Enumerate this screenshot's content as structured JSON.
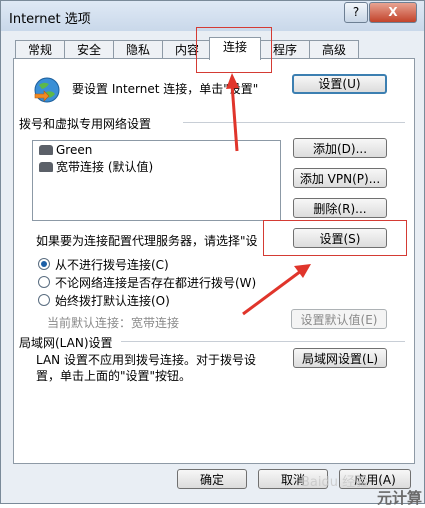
{
  "window": {
    "title": "Internet 选项",
    "help_label": "?",
    "close_label": "X"
  },
  "tabs": [
    "常规",
    "安全",
    "隐私",
    "内容",
    "连接",
    "程序",
    "高级"
  ],
  "active_tab": "连接",
  "setup": {
    "text": "要设置 Internet 连接，单击\"设置\"",
    "button": "设置(U)"
  },
  "dialup": {
    "title": "拨号和虚拟专用网络设置",
    "items": [
      "Green",
      "宽带连接 (默认值)"
    ],
    "add_button": "添加(D)...",
    "add_vpn_button": "添加 VPN(P)...",
    "remove_button": "删除(R)...",
    "proxy_text": "如果要为连接配置代理服务器，请选择\"设",
    "settings_button": "设置(S)",
    "options": [
      "从不进行拨号连接(C)",
      "不论网络连接是否存在都进行拨号(W)",
      "始终拨打默认连接(O)"
    ],
    "selected_option": 0,
    "current_default_label": "当前默认连接：宽带连接",
    "set_default_button": "设置默认值(E)"
  },
  "lan": {
    "title": "局域网(LAN)设置",
    "text_line1": "LAN 设置不应用到拨号连接。对于拨号设",
    "text_line2": "置，单击上面的\"设置\"按钮。",
    "button": "局域网设置(L)"
  },
  "footer": {
    "ok": "确定",
    "cancel": "取消",
    "apply": "应用(A)"
  },
  "watermark": "Baidu 经验",
  "corner_text": "元计算",
  "colors": {
    "accent": "#3c7fb1",
    "highlight_box": "#d43b34",
    "arrow": "#e0352b"
  }
}
